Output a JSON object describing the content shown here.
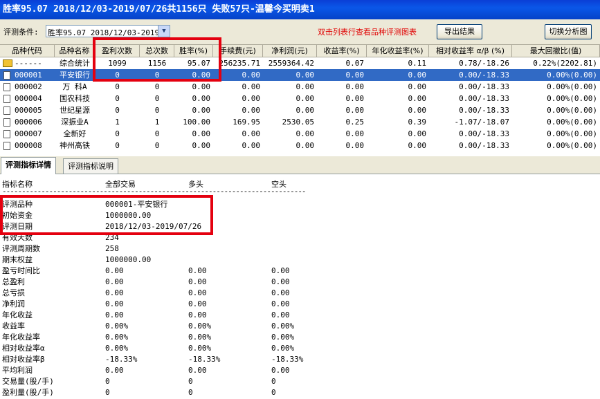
{
  "title": "胜率95.07  2018/12/03-2019/07/26共1156只 失败57只-温馨今买明卖1",
  "toolbar": {
    "condition_label": "评测条件:",
    "condition_value": "胜率95.07  2018/12/03-2019,",
    "hint": "双击列表行查看品种评测图表",
    "export_button": "导出结果",
    "switch_button": "切换分析图"
  },
  "grid": {
    "columns": [
      "品种代码",
      "品种名称",
      "盈利次数",
      "总次数",
      "胜率(%)",
      "手续费(元)",
      "净利润(元)",
      "收益率(%)",
      "年化收益率(%)",
      "相对收益率 α/β (%)",
      "最大回撤比(值)"
    ],
    "rows": [
      {
        "code": "------",
        "name": "综合统计",
        "win": "1099",
        "total": "1156",
        "rate": "95.07",
        "fee": "256235.71",
        "profit": "2559364.42",
        "ret": "0.07",
        "annual": "0.11",
        "relative": "0.78/-18.26",
        "drawdown": "0.22%(2202.81)",
        "icon": "summary-icon",
        "selected": false
      },
      {
        "code": "000001",
        "name": "平安银行",
        "win": "0",
        "total": "0",
        "rate": "0.00",
        "fee": "0.00",
        "profit": "0.00",
        "ret": "0.00",
        "annual": "0.00",
        "relative": "0.00/-18.33",
        "drawdown": "0.00%(0.00)",
        "icon": "file-icon",
        "selected": true
      },
      {
        "code": "000002",
        "name": "万 科A",
        "win": "0",
        "total": "0",
        "rate": "0.00",
        "fee": "0.00",
        "profit": "0.00",
        "ret": "0.00",
        "annual": "0.00",
        "relative": "0.00/-18.33",
        "drawdown": "0.00%(0.00)",
        "icon": "file-icon",
        "selected": false
      },
      {
        "code": "000004",
        "name": "国农科技",
        "win": "0",
        "total": "0",
        "rate": "0.00",
        "fee": "0.00",
        "profit": "0.00",
        "ret": "0.00",
        "annual": "0.00",
        "relative": "0.00/-18.33",
        "drawdown": "0.00%(0.00)",
        "icon": "file-icon",
        "selected": false
      },
      {
        "code": "000005",
        "name": "世纪星源",
        "win": "0",
        "total": "0",
        "rate": "0.00",
        "fee": "0.00",
        "profit": "0.00",
        "ret": "0.00",
        "annual": "0.00",
        "relative": "0.00/-18.33",
        "drawdown": "0.00%(0.00)",
        "icon": "file-icon",
        "selected": false
      },
      {
        "code": "000006",
        "name": "深振业A",
        "win": "1",
        "total": "1",
        "rate": "100.00",
        "fee": "169.95",
        "profit": "2530.05",
        "ret": "0.25",
        "annual": "0.39",
        "relative": "-1.07/-18.07",
        "drawdown": "0.00%(0.00)",
        "icon": "file-icon",
        "selected": false
      },
      {
        "code": "000007",
        "name": "全新好",
        "win": "0",
        "total": "0",
        "rate": "0.00",
        "fee": "0.00",
        "profit": "0.00",
        "ret": "0.00",
        "annual": "0.00",
        "relative": "0.00/-18.33",
        "drawdown": "0.00%(0.00)",
        "icon": "file-icon",
        "selected": false
      },
      {
        "code": "000008",
        "name": "神州高铁",
        "win": "0",
        "total": "0",
        "rate": "0.00",
        "fee": "0.00",
        "profit": "0.00",
        "ret": "0.00",
        "annual": "0.00",
        "relative": "0.00/-18.33",
        "drawdown": "0.00%(0.00)",
        "icon": "file-icon",
        "selected": false
      }
    ]
  },
  "tabs": [
    {
      "label": "评测指标详情",
      "active": true
    },
    {
      "label": "评测指标说明",
      "active": false
    }
  ],
  "detail": {
    "headers": [
      "指标名称",
      "全部交易",
      "多头",
      "空头"
    ],
    "separator": "------------------------------------------------------------------------------------",
    "rows": [
      {
        "name": "评测品种",
        "all": "000001-平安银行",
        "long": "",
        "short": ""
      },
      {
        "name": "初始资金",
        "all": "1000000.00",
        "long": "",
        "short": ""
      },
      {
        "name": "评测日期",
        "all": "2018/12/03-2019/07/26",
        "long": "",
        "short": ""
      },
      {
        "name": "有效天数",
        "all": "234",
        "long": "",
        "short": ""
      },
      {
        "name": "评测周期数",
        "all": "258",
        "long": "",
        "short": ""
      },
      {
        "name": "期末权益",
        "all": "1000000.00",
        "long": "",
        "short": ""
      },
      {
        "name": "盈亏时间比",
        "all": "0.00",
        "long": "0.00",
        "short": "0.00"
      },
      {
        "name": "总盈利",
        "all": "0.00",
        "long": "0.00",
        "short": "0.00"
      },
      {
        "name": "总亏损",
        "all": "0.00",
        "long": "0.00",
        "short": "0.00"
      },
      {
        "name": "净利润",
        "all": "0.00",
        "long": "0.00",
        "short": "0.00"
      },
      {
        "name": "年化收益",
        "all": "0.00",
        "long": "0.00",
        "short": "0.00"
      },
      {
        "name": "收益率",
        "all": "0.00%",
        "long": "0.00%",
        "short": "0.00%"
      },
      {
        "name": "年化收益率",
        "all": "0.00%",
        "long": "0.00%",
        "short": "0.00%"
      },
      {
        "name": "相对收益率α",
        "all": "0.00%",
        "long": "0.00%",
        "short": "0.00%"
      },
      {
        "name": "相对收益率β",
        "all": "-18.33%",
        "long": "-18.33%",
        "short": "-18.33%"
      },
      {
        "name": "平均利润",
        "all": "0.00",
        "long": "0.00",
        "short": "0.00"
      },
      {
        "name": "交易量(股/手)",
        "all": "0",
        "long": "0",
        "short": "0"
      },
      {
        "name": "盈利量(股/手)",
        "all": "0",
        "long": "0",
        "short": "0"
      }
    ]
  },
  "colors": {
    "title_bar": "#0a4fe0",
    "selection": "#316ac5",
    "highlight": "#e4000f"
  }
}
